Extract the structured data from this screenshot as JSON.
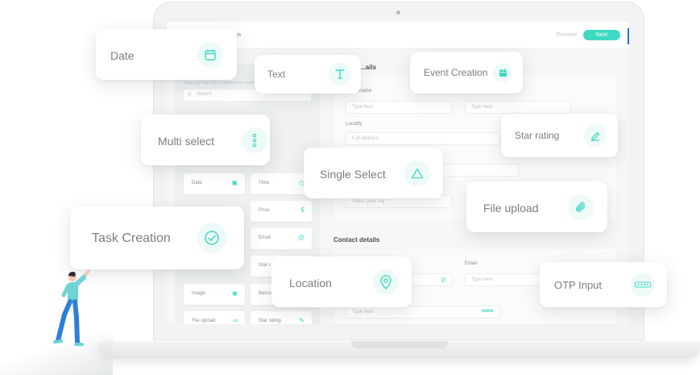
{
  "header": {
    "title": "...n",
    "preview_label": "Preview",
    "next_label": "Next"
  },
  "left_panel": {
    "hint": "Drag and drop these elements to create the form",
    "search_placeholder": "Search",
    "tiles": [
      {
        "label": "Date",
        "icon": "calendar-icon"
      },
      {
        "label": "Time",
        "icon": "clock-icon"
      },
      {
        "label": "Price",
        "icon": "dollar-icon"
      },
      {
        "label": "Email",
        "icon": "at-icon"
      },
      {
        "label": "Star r",
        "icon": "star-icon"
      },
      {
        "label": "Image",
        "icon": "camera-icon"
      },
      {
        "label": "Barco",
        "icon": "barcode-icon"
      },
      {
        "label": "File upload",
        "icon": "paperclip-icon"
      },
      {
        "label": "Star rating",
        "icon": "pencil-icon"
      }
    ]
  },
  "form": {
    "details_title": "...ails",
    "name_label": "...name",
    "first_placeholder": "Type here",
    "second_placeholder": "Type here",
    "locality_label": "Locality",
    "address_placeholder": "Full address",
    "city_placeholder": "Select your city",
    "contact_title": "Contact details",
    "email_label": "Email",
    "email_placeholder": "Type here",
    "website_placeholder": "Type here",
    "website_badge": "www"
  },
  "cards": {
    "date": {
      "label": "Date",
      "icon": "calendar-icon"
    },
    "text": {
      "label": "Text",
      "icon": "text-t-icon"
    },
    "event_creation": {
      "label": "Event Creation",
      "icon": "calendar-filled-icon"
    },
    "multi_select": {
      "label": "Multi select",
      "icon": "vertical-dots-icon"
    },
    "star_rating": {
      "label": "Star rating",
      "icon": "pencil-icon"
    },
    "single_select": {
      "label": "Single Select",
      "icon": "triangle-icon"
    },
    "file_upload": {
      "label": "File upload",
      "icon": "paperclip-icon"
    },
    "task_creation": {
      "label": "Task Creation",
      "icon": "check-circle-icon"
    },
    "location": {
      "label": "Location",
      "icon": "map-pin-icon"
    },
    "otp_input": {
      "label": "OTP Input",
      "icon": "otp-dots-icon"
    }
  },
  "colors": {
    "accent": "#3fd9c1",
    "card_text": "#7a7e82",
    "person_shirt": "#6fd3d6",
    "person_pants": "#2e7fd8"
  }
}
